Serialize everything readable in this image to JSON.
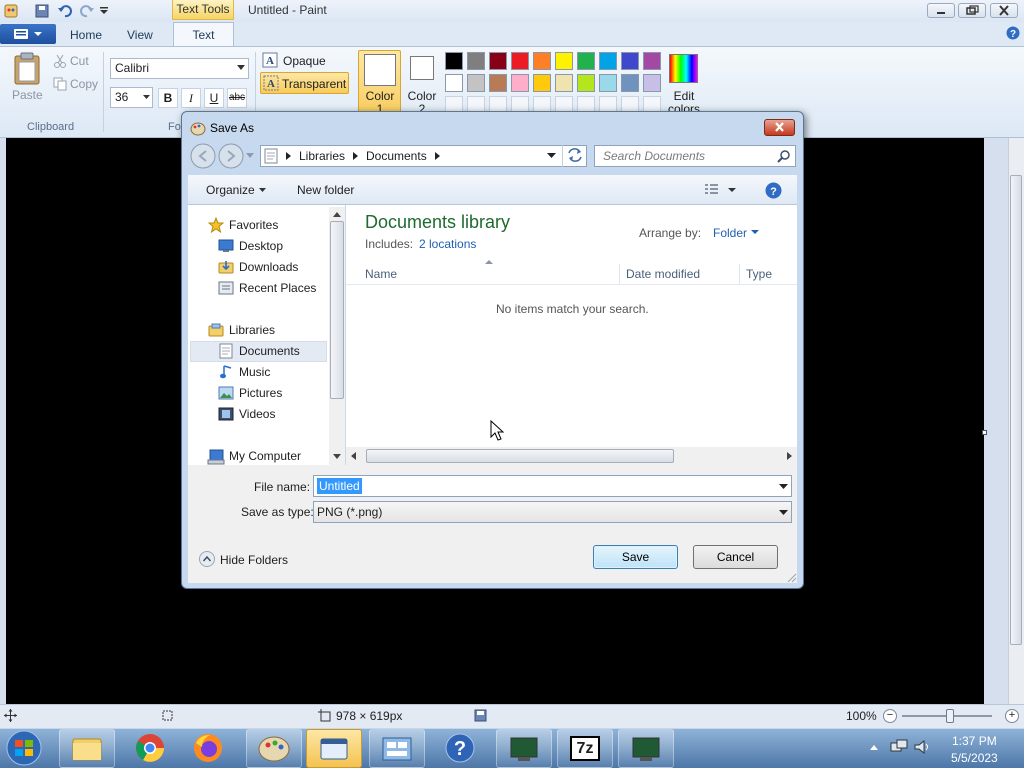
{
  "app": {
    "title": "Untitled - Paint",
    "context_tab": "Text Tools"
  },
  "ribbon": {
    "tabs": [
      "Home",
      "View",
      "Text"
    ],
    "clipboard": {
      "paste": "Paste",
      "cut": "Cut",
      "copy": "Copy",
      "group": "Clipboard"
    },
    "font": {
      "family": "Calibri",
      "size": "36",
      "group": "Fo",
      "bold": "B",
      "italic": "I",
      "underline": "U",
      "strike": "abc"
    },
    "background": {
      "opaque": "Opaque",
      "transparent": "Transparent"
    },
    "colors": {
      "color1_a": "Color",
      "color1_b": "1",
      "color2_a": "Color",
      "color2_b": "2",
      "edit_a": "Edit",
      "edit_b": "colors"
    },
    "palette_row1": [
      "#000000",
      "#7f7f7f",
      "#880015",
      "#ed1c24",
      "#ff7f27",
      "#fff200",
      "#22b14c",
      "#00a2e8",
      "#3f48cc",
      "#a349a4"
    ],
    "palette_row2": [
      "#ffffff",
      "#c3c3c3",
      "#b97a57",
      "#ffaec9",
      "#ffc90e",
      "#efe4b0",
      "#b5e61d",
      "#99d9ea",
      "#7092be",
      "#c8bfe7"
    ]
  },
  "dialog": {
    "title": "Save As",
    "breadcrumb": [
      "Libraries",
      "Documents"
    ],
    "search_placeholder": "Search Documents",
    "organize": "Organize",
    "new_folder": "New folder",
    "nav": {
      "favorites": "Favorites",
      "desktop": "Desktop",
      "downloads": "Downloads",
      "recent": "Recent Places",
      "libraries": "Libraries",
      "documents": "Documents",
      "music": "Music",
      "pictures": "Pictures",
      "videos": "Videos",
      "computer": "My Computer"
    },
    "library_title": "Documents library",
    "includes_label": "Includes:",
    "includes_link": "2 locations",
    "arrange_label": "Arrange by:",
    "arrange_value": "Folder",
    "columns": [
      "Name",
      "Date modified",
      "Type"
    ],
    "empty_message": "No items match your search.",
    "file_name_label": "File name:",
    "file_name_value": "Untitled",
    "save_type_label": "Save as type:",
    "save_type_value": "PNG (*.png)",
    "hide_folders": "Hide Folders",
    "save": "Save",
    "cancel": "Cancel"
  },
  "status": {
    "size": "978 × 619px",
    "zoom": "100%"
  },
  "taskbar": {
    "time": "1:37 PM",
    "date": "5/5/2023",
    "sevenzip": "7z"
  }
}
